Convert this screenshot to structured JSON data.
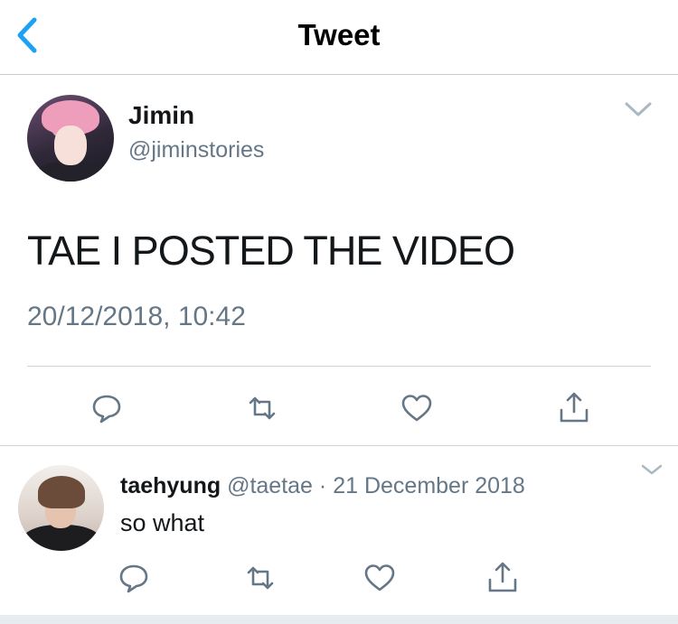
{
  "header": {
    "title": "Tweet",
    "back_icon": "chevron-left-icon"
  },
  "colors": {
    "accent": "#1da1f2",
    "secondary_text": "#657786",
    "divider": "#ccd6dd"
  },
  "main_tweet": {
    "display_name": "Jimin",
    "handle": "@jiminstories",
    "text": "TAE I POSTED THE VIDEO",
    "timestamp": "20/12/2018, 10:42",
    "actions": [
      "reply-icon",
      "retweet-icon",
      "like-icon",
      "share-icon"
    ]
  },
  "reply": {
    "display_name": "taehyung",
    "handle": "@taetae",
    "separator": "·",
    "date": "21 December 2018",
    "text": "so what",
    "actions": [
      "reply-icon",
      "retweet-icon",
      "like-icon",
      "share-icon"
    ]
  }
}
